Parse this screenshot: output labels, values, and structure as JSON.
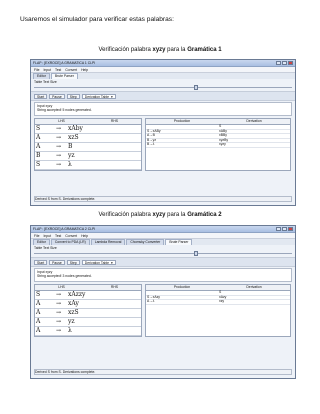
{
  "intro": "Usaremos el simulador para verificar estas palabras:",
  "captions": [
    {
      "prefix": "Verificación palabra",
      "word": "xyzy",
      "mid": "para la",
      "grammar": "Gramática 1"
    },
    {
      "prefix": "Verificación palabra",
      "word": "xyzy",
      "mid": "para la",
      "grammar": "Gramática 2"
    }
  ],
  "windows": [
    {
      "title": "FLAP : [EXROCE] A GRAMATICA 1 CLPI",
      "menu": [
        "File",
        "Input",
        "Test",
        "Convert",
        "Help"
      ],
      "tabs": [
        "Editor",
        "Brute Parser"
      ],
      "table_text_size_label": "Table Text Size",
      "buttons": [
        "Start",
        "Pause",
        "Step"
      ],
      "select_value": "Derivation Table",
      "input_label": "Input",
      "input_value": "xyzy",
      "result": "String accepted! 5 nodes generated.",
      "derivation_header": [
        "LHS",
        "RHS"
      ],
      "derivation_rows": [
        {
          "lhs": "S",
          "rhs": "xAby"
        },
        {
          "lhs": "A",
          "rhs": "xzS"
        },
        {
          "lhs": "A",
          "rhs": "B"
        },
        {
          "lhs": "B",
          "rhs": "yz"
        },
        {
          "lhs": "S",
          "rhs": "λ"
        }
      ],
      "production_header": [
        "Production",
        "Derivation"
      ],
      "production_rows": [
        {
          "production": "",
          "derivation": "S"
        },
        {
          "production": "S→xABy",
          "derivation": "xABy"
        },
        {
          "production": "A→B",
          "derivation": "xBBy"
        },
        {
          "production": "B→yz",
          "derivation": "xyzBy"
        },
        {
          "production": "B→λ",
          "derivation": "xyzy"
        }
      ],
      "status": "Derived S from S. Derivations complete."
    },
    {
      "title": "FLAP : [EXROCE] A GRAMATICA 2 CLPI",
      "menu": [
        "File",
        "Input",
        "Test",
        "Convert",
        "Help"
      ],
      "tabs": [
        "Editor",
        "Convert to PDA (LR)",
        "Lambda Removal",
        "Chomsky Converter",
        "Brute Parser"
      ],
      "table_text_size_label": "Table Text Size",
      "buttons": [
        "Start",
        "Pause",
        "Step"
      ],
      "select_value": "Derivation Table",
      "input_label": "Input",
      "input_value": "xyzy",
      "result": "String accepted! 3 nodes generated.",
      "derivation_header": [
        "LHS",
        "RHS"
      ],
      "derivation_rows": [
        {
          "lhs": "S",
          "rhs": "xAzzy"
        },
        {
          "lhs": "A",
          "rhs": "xAy"
        },
        {
          "lhs": "A",
          "rhs": "xzS"
        },
        {
          "lhs": "A",
          "rhs": "yz"
        },
        {
          "lhs": "A",
          "rhs": "λ"
        }
      ],
      "production_header": [
        "Production",
        "Derivation"
      ],
      "production_rows": [
        {
          "production": "",
          "derivation": "S"
        },
        {
          "production": "S→xAzy",
          "derivation": "xAzy"
        },
        {
          "production": "A→λ",
          "derivation": "xzy"
        }
      ],
      "status": "Derived S from S. Derivations complete."
    }
  ]
}
